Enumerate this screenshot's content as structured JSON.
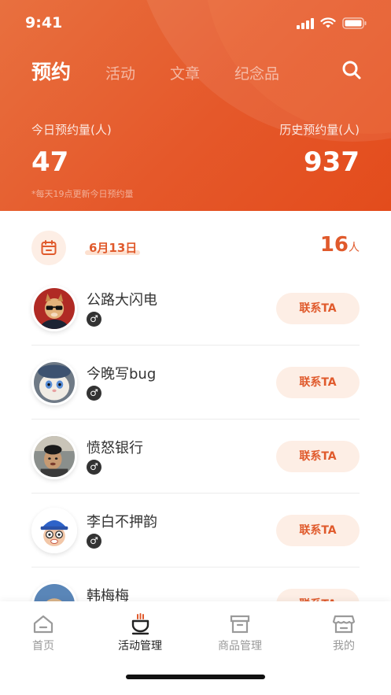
{
  "status_bar": {
    "time": "9:41"
  },
  "nav": {
    "tabs": [
      {
        "label": "预约",
        "active": true
      },
      {
        "label": "活动",
        "active": false
      },
      {
        "label": "文章",
        "active": false
      },
      {
        "label": "纪念品",
        "active": false
      }
    ],
    "search_icon": "search-icon"
  },
  "stats": {
    "today_label": "今日预约量(人)",
    "today_value": "47",
    "history_label": "历史预约量(人)",
    "history_value": "937",
    "note": "*每天19点更新今日预约量"
  },
  "date_row": {
    "icon": "calendar-icon",
    "date": "6月13日",
    "count": "16",
    "count_unit": "人"
  },
  "reservations": [
    {
      "name": "公路大闪电",
      "gender_symbol": "♂",
      "action": "联系TA"
    },
    {
      "name": "今晚写bug",
      "gender_symbol": "♂",
      "action": "联系TA"
    },
    {
      "name": "愤怒银行",
      "gender_symbol": "♂",
      "action": "联系TA"
    },
    {
      "name": "李白不押韵",
      "gender_symbol": "♂",
      "action": "联系TA"
    },
    {
      "name": "韩梅梅",
      "gender_symbol": "♂",
      "action": "联系TA"
    }
  ],
  "tabbar": {
    "items": [
      {
        "label": "首页",
        "icon": "home-icon",
        "active": false
      },
      {
        "label": "活动管理",
        "icon": "activity-icon",
        "active": true
      },
      {
        "label": "商品管理",
        "icon": "goods-box-icon",
        "active": false
      },
      {
        "label": "我的",
        "icon": "store-icon",
        "active": false
      }
    ]
  },
  "colors": {
    "accent": "#e05a2c",
    "header_gradient_start": "#e8703f",
    "header_gradient_end": "#e34c1c",
    "button_bg": "#fdeee5"
  }
}
